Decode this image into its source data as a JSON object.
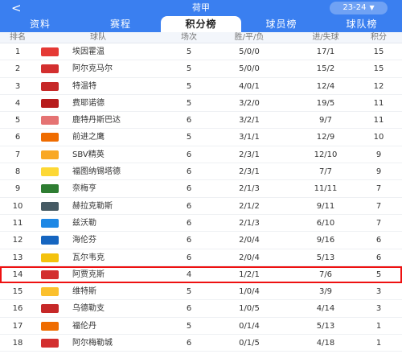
{
  "header": {
    "back_icon": "chevron-left-icon",
    "title": "荷甲",
    "season": "23-24",
    "season_icon": "caret-down-icon"
  },
  "tabs": [
    {
      "label": "资料",
      "active": false
    },
    {
      "label": "赛程",
      "active": false
    },
    {
      "label": "积分榜",
      "active": true
    },
    {
      "label": "球员榜",
      "active": false
    },
    {
      "label": "球队榜",
      "active": false
    }
  ],
  "columns": {
    "rank": "排名",
    "team": "球队",
    "played": "场次",
    "wdl": "胜/平/负",
    "gfga": "进/失球",
    "pts": "积分"
  },
  "colors": {
    "accent": "#3a7ff0",
    "highlight": "#e11111"
  },
  "rows": [
    {
      "rank": "1",
      "name": "埃因霍温",
      "played": "5",
      "wdl": "5/0/0",
      "gfga": "17/1",
      "pts": "15",
      "logo": "#e53935"
    },
    {
      "rank": "2",
      "name": "阿尔克马尔",
      "played": "5",
      "wdl": "5/0/0",
      "gfga": "15/2",
      "pts": "15",
      "logo": "#d32f2f"
    },
    {
      "rank": "3",
      "name": "特温特",
      "played": "5",
      "wdl": "4/0/1",
      "gfga": "12/4",
      "pts": "12",
      "logo": "#c62828"
    },
    {
      "rank": "4",
      "name": "费耶诺德",
      "played": "5",
      "wdl": "3/2/0",
      "gfga": "19/5",
      "pts": "11",
      "logo": "#b71c1c"
    },
    {
      "rank": "5",
      "name": "鹿特丹斯巴达",
      "played": "6",
      "wdl": "3/2/1",
      "gfga": "9/7",
      "pts": "11",
      "logo": "#e57373"
    },
    {
      "rank": "6",
      "name": "前进之鹰",
      "played": "5",
      "wdl": "3/1/1",
      "gfga": "12/9",
      "pts": "10",
      "logo": "#ef6c00"
    },
    {
      "rank": "7",
      "name": "SBV精英",
      "played": "6",
      "wdl": "2/3/1",
      "gfga": "12/10",
      "pts": "9",
      "logo": "#f9a825"
    },
    {
      "rank": "8",
      "name": "福图纳锡塔德",
      "played": "6",
      "wdl": "2/3/1",
      "gfga": "7/7",
      "pts": "9",
      "logo": "#fdd835"
    },
    {
      "rank": "9",
      "name": "奈梅亨",
      "played": "6",
      "wdl": "2/1/3",
      "gfga": "11/11",
      "pts": "7",
      "logo": "#2e7d32"
    },
    {
      "rank": "10",
      "name": "赫拉克勒斯",
      "played": "6",
      "wdl": "2/1/2",
      "gfga": "9/11",
      "pts": "7",
      "logo": "#455a64"
    },
    {
      "rank": "11",
      "name": "兹沃勒",
      "played": "6",
      "wdl": "2/1/3",
      "gfga": "6/10",
      "pts": "7",
      "logo": "#1e88e5"
    },
    {
      "rank": "12",
      "name": "海伦芬",
      "played": "6",
      "wdl": "2/0/4",
      "gfga": "9/16",
      "pts": "6",
      "logo": "#1565c0"
    },
    {
      "rank": "13",
      "name": "瓦尔韦克",
      "played": "6",
      "wdl": "2/0/4",
      "gfga": "5/13",
      "pts": "6",
      "logo": "#f4c20d"
    },
    {
      "rank": "14",
      "name": "阿贾克斯",
      "played": "4",
      "wdl": "1/2/1",
      "gfga": "7/6",
      "pts": "5",
      "logo": "#d32f2f",
      "highlight": true
    },
    {
      "rank": "15",
      "name": "维特斯",
      "played": "5",
      "wdl": "1/0/4",
      "gfga": "3/9",
      "pts": "3",
      "logo": "#fbc02d"
    },
    {
      "rank": "16",
      "name": "乌德勒支",
      "played": "6",
      "wdl": "1/0/5",
      "gfga": "4/14",
      "pts": "3",
      "logo": "#c62828"
    },
    {
      "rank": "17",
      "name": "福伦丹",
      "played": "5",
      "wdl": "0/1/4",
      "gfga": "5/13",
      "pts": "1",
      "logo": "#ef6c00"
    },
    {
      "rank": "18",
      "name": "阿尔梅勒城",
      "played": "6",
      "wdl": "0/1/5",
      "gfga": "4/18",
      "pts": "1",
      "logo": "#d32f2f"
    }
  ]
}
